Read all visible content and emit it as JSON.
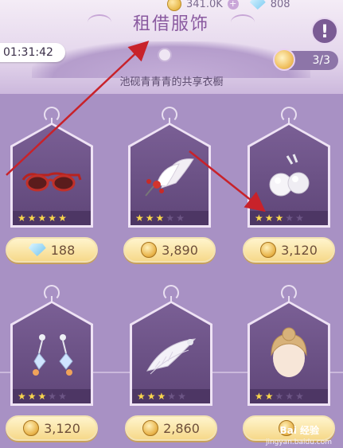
{
  "header": {
    "coins": "341.0K",
    "gems": "808",
    "title": "租借服饰",
    "timer": "01:31:42",
    "counter": "3/3",
    "subtitle": "池砚青青青的共享衣橱",
    "info_label": "!"
  },
  "items": [
    {
      "name": "sunglasses",
      "price": "188",
      "currency": "gem",
      "stars": 5,
      "max_stars": 5
    },
    {
      "name": "feather-hairpin",
      "price": "3,890",
      "currency": "coin",
      "stars": 3,
      "max_stars": 5
    },
    {
      "name": "pearl-earrings",
      "price": "3,120",
      "currency": "coin",
      "stars": 3,
      "max_stars": 5
    },
    {
      "name": "drop-earrings",
      "price": "3,120",
      "currency": "coin",
      "stars": 3,
      "max_stars": 5
    },
    {
      "name": "feather-ornament",
      "price": "2,860",
      "currency": "coin",
      "stars": 3,
      "max_stars": 5
    },
    {
      "name": "updo-hairstyle",
      "price": "",
      "currency": "coin",
      "stars": 2,
      "max_stars": 5
    }
  ],
  "watermark": {
    "logo": "Bai 经验",
    "url": "jingyan.baidu.com"
  },
  "colors": {
    "accent": "#8a5aa0",
    "arrow": "#c8222a",
    "panel": "#a891c4",
    "star": "#f9d64c"
  }
}
